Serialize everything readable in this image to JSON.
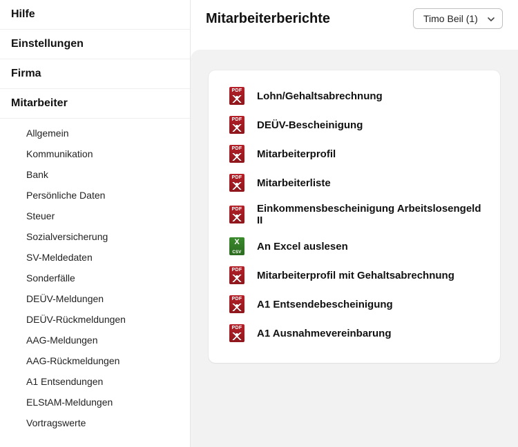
{
  "sidebar": {
    "primary": [
      {
        "label": "Hilfe"
      },
      {
        "label": "Einstellungen"
      },
      {
        "label": "Firma"
      },
      {
        "label": "Mitarbeiter"
      }
    ],
    "mitarbeiter_sub": [
      {
        "label": "Allgemein"
      },
      {
        "label": "Kommunikation"
      },
      {
        "label": "Bank"
      },
      {
        "label": "Persönliche Daten"
      },
      {
        "label": "Steuer"
      },
      {
        "label": "Sozialversicherung"
      },
      {
        "label": "SV-Meldedaten"
      },
      {
        "label": "Sonderfälle"
      },
      {
        "label": "DEÜV-Meldungen"
      },
      {
        "label": "DEÜV-Rückmeldungen"
      },
      {
        "label": "AAG-Meldungen"
      },
      {
        "label": "AAG-Rückmeldungen"
      },
      {
        "label": "A1 Entsendungen"
      },
      {
        "label": "ELStAM-Meldungen"
      },
      {
        "label": "Vortragswerte"
      }
    ]
  },
  "header": {
    "title": "Mitarbeiterberichte",
    "picker_value": "Timo Beil (1)"
  },
  "reports": [
    {
      "icon": "pdf",
      "label": "Lohn/Gehaltsabrechnung"
    },
    {
      "icon": "pdf",
      "label": "DEÜV-Bescheinigung"
    },
    {
      "icon": "pdf",
      "label": "Mitarbeiterprofil"
    },
    {
      "icon": "pdf",
      "label": "Mitarbeiterliste"
    },
    {
      "icon": "pdf",
      "label": "Einkommensbescheinigung Arbeitslosengeld II"
    },
    {
      "icon": "csv",
      "label": "An Excel auslesen"
    },
    {
      "icon": "pdf",
      "label": "Mitarbeiterprofil mit Gehaltsabrechnung"
    },
    {
      "icon": "pdf",
      "label": "A1 Entsendebescheinigung"
    },
    {
      "icon": "pdf",
      "label": "A1 Ausnahmevereinbarung"
    }
  ]
}
